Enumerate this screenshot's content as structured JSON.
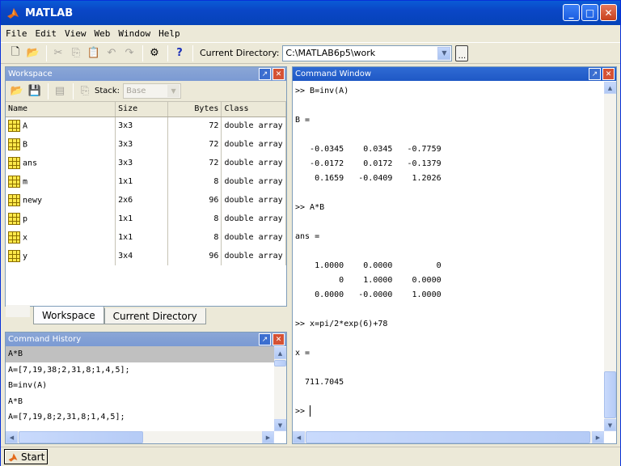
{
  "window": {
    "title": "MATLAB"
  },
  "menu": [
    "File",
    "Edit",
    "View",
    "Web",
    "Window",
    "Help"
  ],
  "toolbar": {
    "current_directory_label": "Current Directory:",
    "current_directory_value": "C:\\MATLAB6p5\\work",
    "browse_label": "...",
    "help_label": "?"
  },
  "workspace": {
    "title": "Workspace",
    "stack_label": "Stack:",
    "stack_value": "Base",
    "columns": [
      "Name",
      "Size",
      "Bytes",
      "Class"
    ],
    "rows": [
      {
        "name": "A",
        "size": "3x3",
        "bytes": "72",
        "class": "double array"
      },
      {
        "name": "B",
        "size": "3x3",
        "bytes": "72",
        "class": "double array"
      },
      {
        "name": "ans",
        "size": "3x3",
        "bytes": "72",
        "class": "double array"
      },
      {
        "name": "m",
        "size": "1x1",
        "bytes": "8",
        "class": "double array"
      },
      {
        "name": "newy",
        "size": "2x6",
        "bytes": "96",
        "class": "double array"
      },
      {
        "name": "p",
        "size": "1x1",
        "bytes": "8",
        "class": "double array"
      },
      {
        "name": "x",
        "size": "1x1",
        "bytes": "8",
        "class": "double array"
      },
      {
        "name": "y",
        "size": "3x4",
        "bytes": "96",
        "class": "double array"
      }
    ],
    "tabs": [
      "Workspace",
      "Current Directory"
    ]
  },
  "history": {
    "title": "Command History",
    "lines": [
      "A*B",
      "A=[7,19,38;2,31,8;1,4,5];",
      "B=inv(A)",
      "A*B",
      "A=[7,19,8;2,31,8;1,4,5];"
    ]
  },
  "command": {
    "title": "Command Window",
    "lines": [
      ">> B=inv(A)",
      "",
      "B =",
      "",
      "   -0.0345    0.0345   -0.7759",
      "   -0.0172    0.0172   -0.1379",
      "    0.1659   -0.0409    1.2026",
      "",
      ">> A*B",
      "",
      "ans =",
      "",
      "    1.0000    0.0000         0",
      "         0    1.0000    0.0000",
      "    0.0000   -0.0000    1.0000",
      "",
      ">> x=pi/2*exp(6)+78",
      "",
      "x =",
      "",
      "  711.7045",
      "",
      ">> "
    ]
  },
  "status": {
    "start_label": "Start"
  },
  "colors": {
    "titlebar": "#0a46c6",
    "panel_header": "#2f6bd4",
    "chrome": "#ece9d8"
  }
}
